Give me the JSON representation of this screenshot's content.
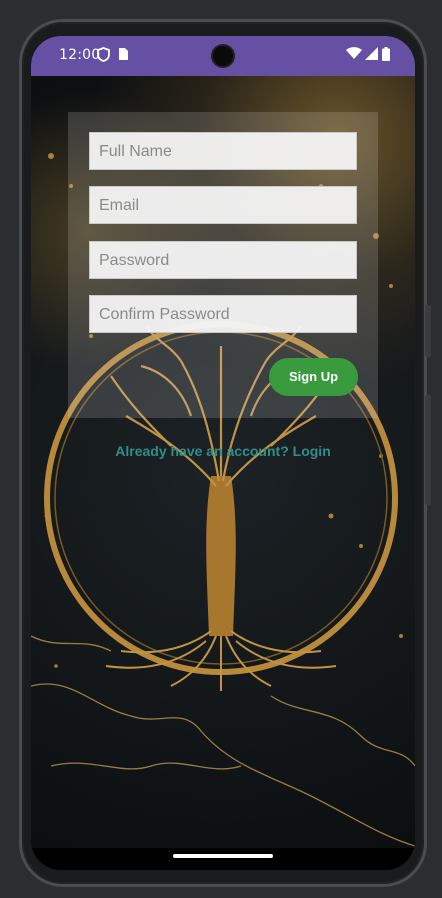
{
  "status_bar": {
    "time": "12:00",
    "icons": [
      "shield-icon",
      "sim-card-icon",
      "wifi-icon",
      "cellular-signal-icon",
      "battery-icon"
    ]
  },
  "signup_form": {
    "full_name_placeholder": "Full Name",
    "email_placeholder": "Email",
    "password_placeholder": "Password",
    "confirm_password_placeholder": "Confirm Password",
    "sign_up_label": "Sign Up"
  },
  "login_prompt": "Already have an account? Login",
  "colors": {
    "status_bar": "#6650a4",
    "sign_up_button": "#3a9a3e",
    "login_link": "#2f8f8a",
    "gold_accent": "#c99a45"
  }
}
